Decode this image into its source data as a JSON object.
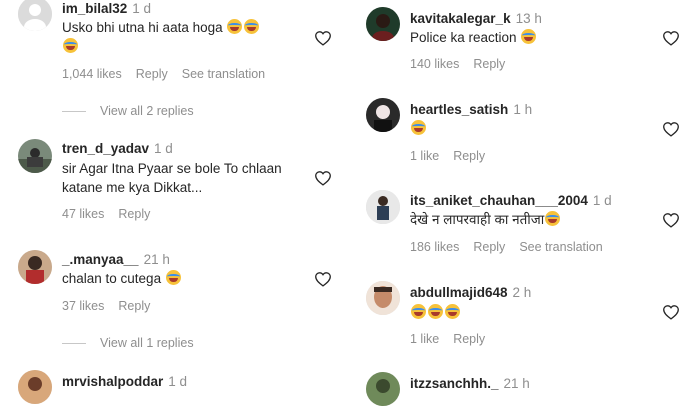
{
  "left": [
    {
      "user": "im_bilal32",
      "time": "1 d",
      "text": "Usko bhi utna hi aata hoga",
      "emoji_after": 2,
      "emoji_line2": 1,
      "likes": "1,044 likes",
      "reply": "Reply",
      "translate": "See translation",
      "view_replies": "View all 2 replies"
    },
    {
      "user": "tren_d_yadav",
      "time": "1 d",
      "text": "sir Agar Itna Pyaar se bole To chlaan katane me kya Dikkat...",
      "likes": "47 likes",
      "reply": "Reply"
    },
    {
      "user": "_.manyaa__",
      "time": "21 h",
      "text": "chalan to cutega",
      "emoji_after": 1,
      "likes": "37 likes",
      "reply": "Reply",
      "view_replies": "View all 1 replies"
    },
    {
      "user": "mrvishalpoddar",
      "time": "1 d"
    }
  ],
  "right": [
    {
      "user": "kavitakalegar_k",
      "time": "13 h",
      "text": "Police ka reaction",
      "emoji_after": 1,
      "likes": "140 likes",
      "reply": "Reply"
    },
    {
      "user": "heartles_satish",
      "time": "1 h",
      "emoji_line1": 1,
      "likes": "1 like",
      "reply": "Reply"
    },
    {
      "user": "its_aniket_chauhan___2004",
      "time": "1 d",
      "text": "देखे न लापरवाही का नतीजा",
      "emoji_after": 1,
      "likes": "186 likes",
      "reply": "Reply",
      "translate": "See translation"
    },
    {
      "user": "abdullmajid648",
      "time": "2 h",
      "emoji_line1": 3,
      "likes": "1 like",
      "reply": "Reply"
    },
    {
      "user": "itzzsanchhh._",
      "time": "21 h"
    }
  ],
  "icons": {
    "like": "heart-outline-icon",
    "emoji": "laughing-emoji-icon"
  }
}
